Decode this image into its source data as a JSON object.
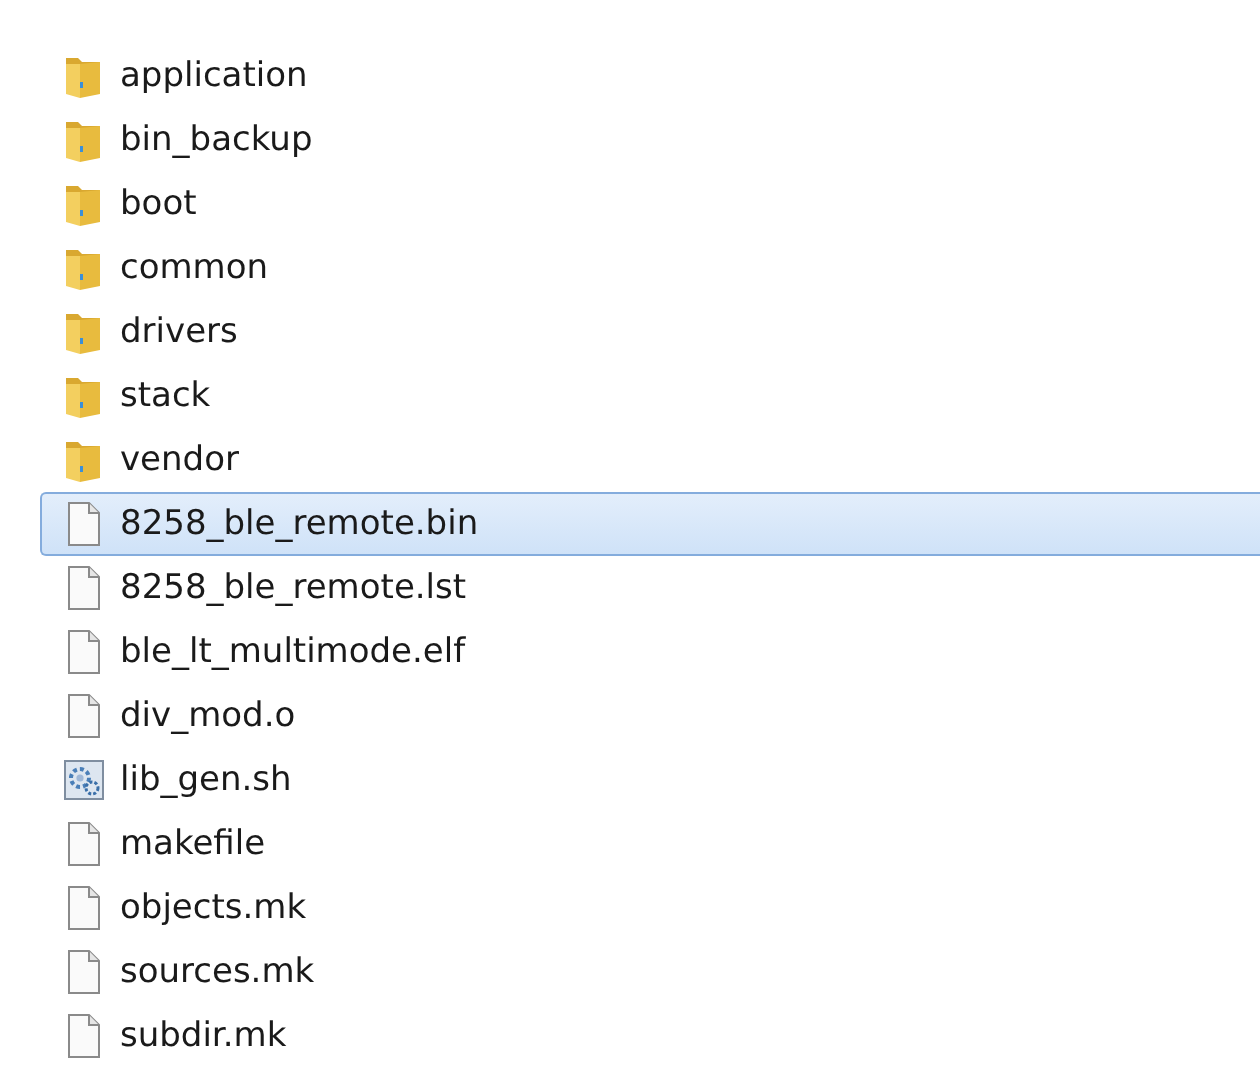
{
  "files": [
    {
      "name": "application",
      "kind": "folder",
      "selected": false
    },
    {
      "name": "bin_backup",
      "kind": "folder",
      "selected": false
    },
    {
      "name": "boot",
      "kind": "folder",
      "selected": false
    },
    {
      "name": "common",
      "kind": "folder",
      "selected": false
    },
    {
      "name": "drivers",
      "kind": "folder",
      "selected": false
    },
    {
      "name": "stack",
      "kind": "folder",
      "selected": false
    },
    {
      "name": "vendor",
      "kind": "folder",
      "selected": false
    },
    {
      "name": "8258_ble_remote.bin",
      "kind": "file",
      "selected": true
    },
    {
      "name": "8258_ble_remote.lst",
      "kind": "file",
      "selected": false
    },
    {
      "name": "ble_lt_multimode.elf",
      "kind": "file",
      "selected": false
    },
    {
      "name": "div_mod.o",
      "kind": "file",
      "selected": false
    },
    {
      "name": "lib_gen.sh",
      "kind": "script",
      "selected": false
    },
    {
      "name": "makefile",
      "kind": "file",
      "selected": false
    },
    {
      "name": "objects.mk",
      "kind": "file",
      "selected": false
    },
    {
      "name": "sources.mk",
      "kind": "file",
      "selected": false
    },
    {
      "name": "subdir.mk",
      "kind": "file",
      "selected": false
    }
  ]
}
